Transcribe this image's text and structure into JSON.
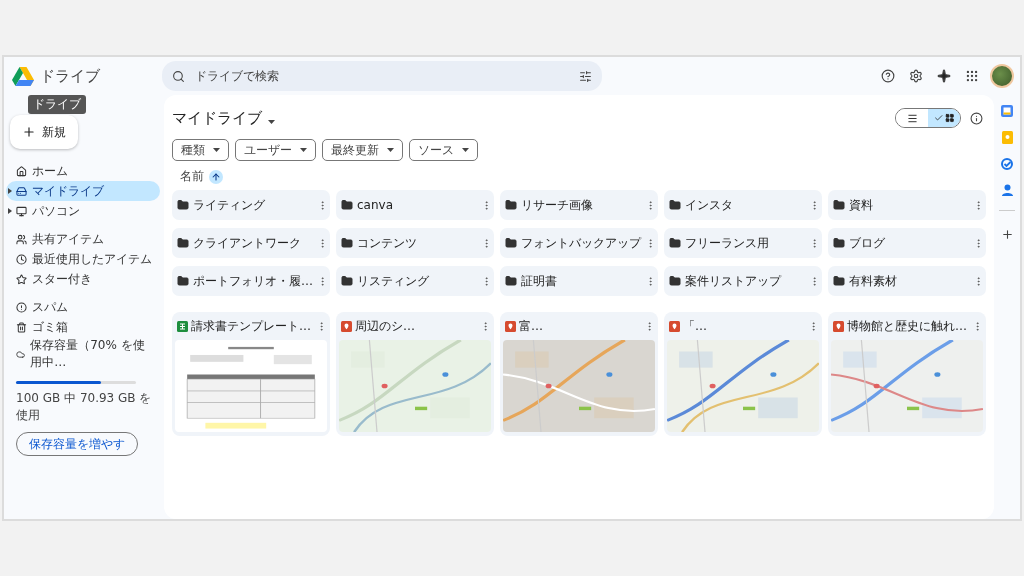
{
  "app": {
    "title": "ドライブ",
    "tooltip": "ドライブ"
  },
  "new_button": {
    "label": "新規"
  },
  "sidebar": {
    "groups": [
      {
        "items": [
          {
            "label": "ホーム",
            "kind": "home",
            "selected": false,
            "expandable": false
          },
          {
            "label": "マイドライブ",
            "kind": "drive",
            "selected": true,
            "expandable": true
          },
          {
            "label": "パソコン",
            "kind": "computer",
            "selected": false,
            "expandable": true
          }
        ]
      },
      {
        "items": [
          {
            "label": "共有アイテム",
            "kind": "shared",
            "selected": false,
            "expandable": false
          },
          {
            "label": "最近使用したアイテム",
            "kind": "recent",
            "selected": false,
            "expandable": false
          },
          {
            "label": "スター付き",
            "kind": "starred",
            "selected": false,
            "expandable": false
          }
        ]
      },
      {
        "items": [
          {
            "label": "スパム",
            "kind": "spam",
            "selected": false,
            "expandable": false
          },
          {
            "label": "ゴミ箱",
            "kind": "trash",
            "selected": false,
            "expandable": false
          },
          {
            "label": "保存容量（70% を使用中…",
            "kind": "storage",
            "selected": false,
            "expandable": false
          }
        ]
      }
    ]
  },
  "storage": {
    "level": 0.71,
    "usage": "100 GB 中 70.93 GB を使用",
    "button": "保存容量を増やす"
  },
  "search": {
    "placeholder": "ドライブで検索"
  },
  "main": {
    "title": "マイドライブ",
    "views": [
      {
        "kind": "list",
        "selected": false
      },
      {
        "kind": "grid",
        "selected": true
      }
    ],
    "filters": [
      "種類",
      "ユーザー",
      "最終更新",
      "ソース"
    ],
    "sort": {
      "label": "名前"
    },
    "folders": [
      "ライティング",
      "canva",
      "リサーチ画像",
      "インスタ",
      "資料",
      "クライアントワーク",
      "コンテンツ",
      "フォントバックアップ",
      "フリーランス用",
      "ブログ",
      "ポートフォリオ・履…",
      "リスティング",
      "証明書",
      "案件リストアップ",
      "有料素材"
    ],
    "files": [
      {
        "title": "請求書テンプレート…",
        "kind": "sheet"
      },
      {
        "title": "周辺のシ…",
        "kind": "map"
      },
      {
        "title": "富…",
        "kind": "map"
      },
      {
        "title": "「…",
        "kind": "map"
      },
      {
        "title": "博物館と歴史に触れ…",
        "kind": "map"
      }
    ]
  }
}
